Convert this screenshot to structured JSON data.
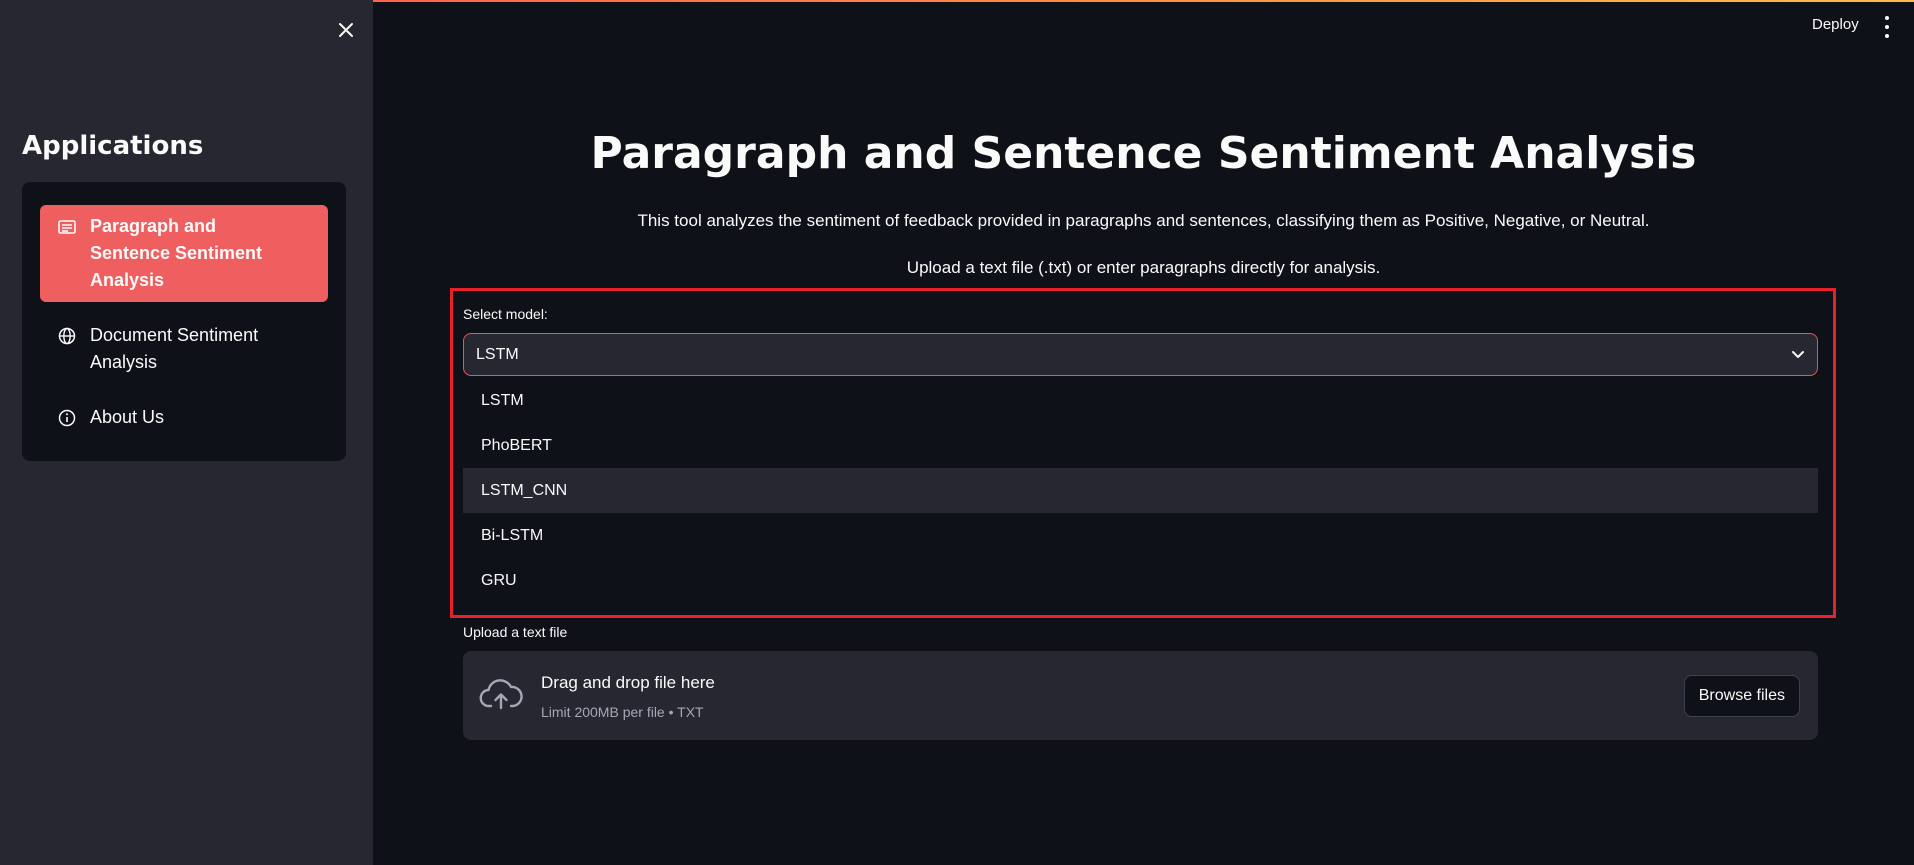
{
  "header": {
    "deploy_label": "Deploy"
  },
  "sidebar": {
    "title": "Applications",
    "items": [
      {
        "label": "Paragraph and Sentence Sentiment Analysis",
        "icon": "document-lines-icon",
        "active": true
      },
      {
        "label": "Document Sentiment Analysis",
        "icon": "globe-icon",
        "active": false
      },
      {
        "label": "About Us",
        "icon": "info-icon",
        "active": false
      }
    ]
  },
  "main": {
    "title": "Paragraph and Sentence Sentiment Analysis",
    "description": "This tool analyzes the sentiment of feedback provided in paragraphs and sentences, classifying them as Positive, Negative, or Neutral.",
    "instruction": "Upload a text file (.txt) or enter paragraphs directly for analysis.",
    "model_select": {
      "label": "Select model:",
      "value": "LSTM",
      "options": [
        "LSTM",
        "PhoBERT",
        "LSTM_CNN",
        "Bi-LSTM",
        "GRU"
      ],
      "hovered": "LSTM_CNN"
    },
    "uploader": {
      "label": "Upload a text file",
      "title": "Drag and drop file here",
      "subtitle": "Limit 200MB per file • TXT",
      "browse_label": "Browse files"
    }
  },
  "colors": {
    "accent": "#ff4b4b",
    "active_item": "#f05f5f",
    "highlight_border": "#e8202a",
    "background": "#0e1117",
    "sidebar": "#262730"
  }
}
